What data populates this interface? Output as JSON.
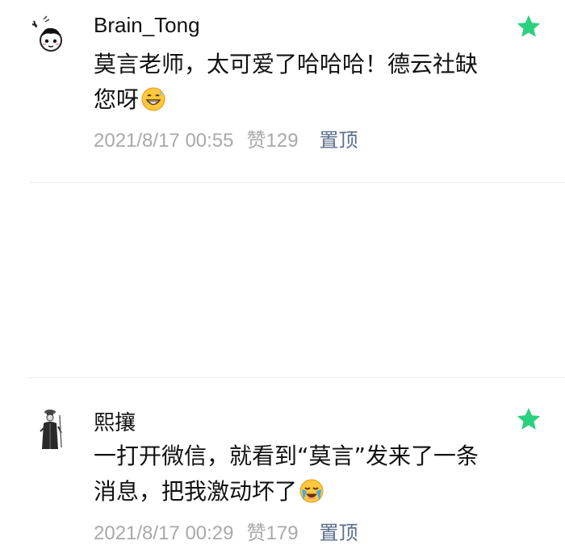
{
  "comments": [
    {
      "username": "Brain_Tong",
      "text": "莫言老师，太可爱了哈哈哈！德云社缺您呀",
      "emoji": "grinning-sweat-emoji",
      "timestamp": "2021/8/17 00:55",
      "likes": "赞129",
      "pin_label": "置顶",
      "starred": true
    },
    {
      "username": "熙攘",
      "text": "一打开微信，就看到“莫言”发来了一条消息，把我激动坏了",
      "emoji": "crying-emoji",
      "timestamp": "2021/8/17 00:29",
      "likes": "赞179",
      "pin_label": "置顶",
      "starred": true
    }
  ],
  "colors": {
    "star": "#2bd17e",
    "meta": "#a9a9a9",
    "pin": "#5a6e8c",
    "divider": "#ececec"
  }
}
